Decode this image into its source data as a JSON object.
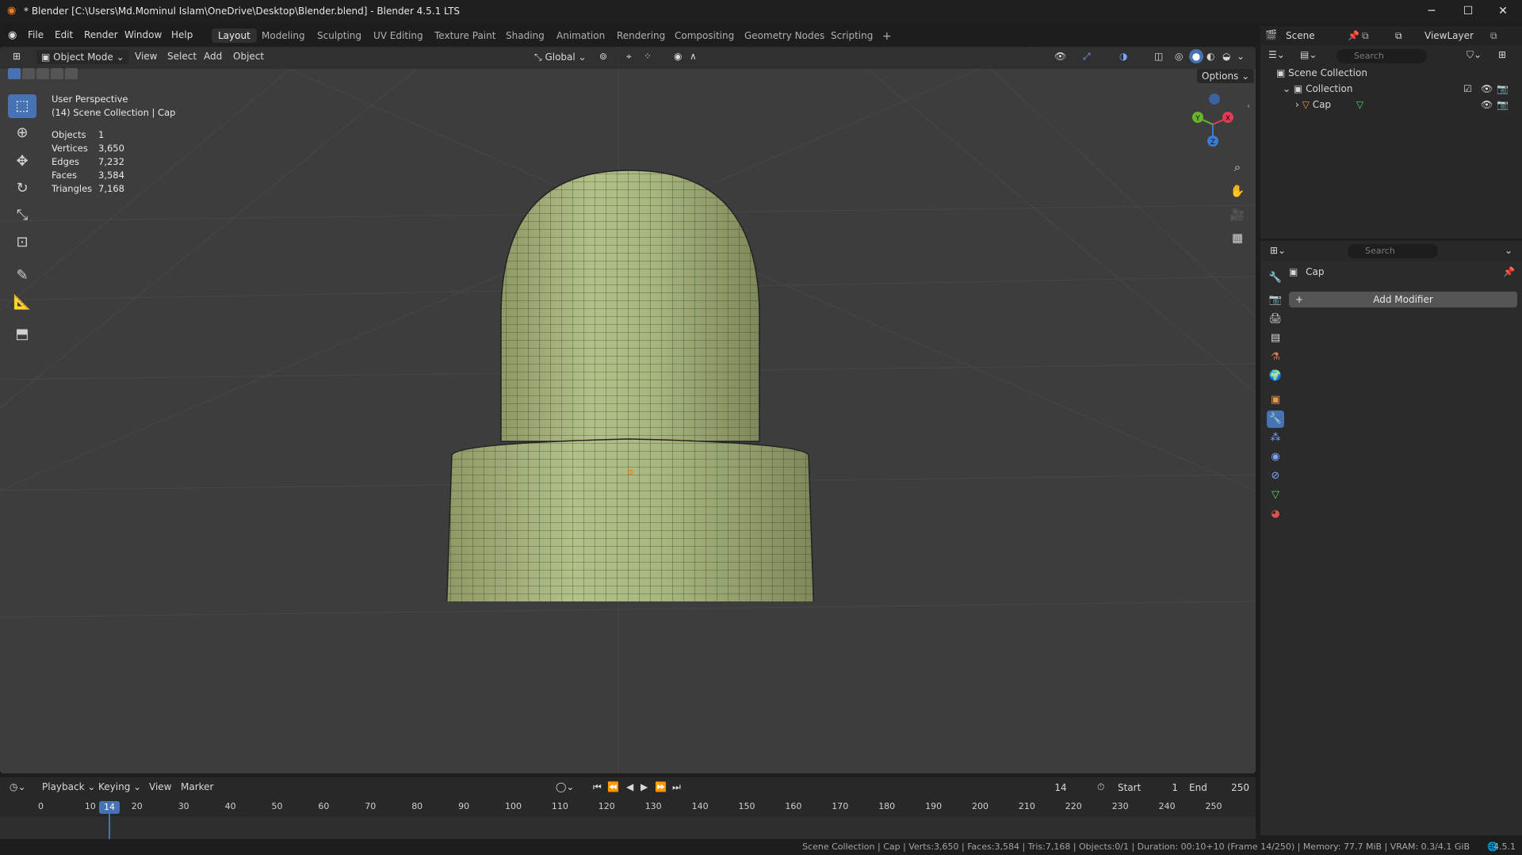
{
  "window": {
    "title": "* Blender [C:\\Users\\Md.Mominul Islam\\OneDrive\\Desktop\\Blender.blend] - Blender 4.5.1 LTS",
    "minimize": "─",
    "maximize": "☐",
    "close": "✕"
  },
  "menu": {
    "file": "File",
    "edit": "Edit",
    "render": "Render",
    "window": "Window",
    "help": "Help"
  },
  "workspaces": [
    "Layout",
    "Modeling",
    "Sculpting",
    "UV Editing",
    "Texture Paint",
    "Shading",
    "Animation",
    "Rendering",
    "Compositing",
    "Geometry Nodes",
    "Scripting"
  ],
  "workspace_add": "+",
  "viewport_header": {
    "mode": "Object Mode",
    "view": "View",
    "select": "Select",
    "add": "Add",
    "object": "Object",
    "transform_orientation": "Global",
    "options": "Options"
  },
  "overlay_info": {
    "perspective": "User Perspective",
    "collection_line": "(14) Scene Collection | Cap",
    "stats": [
      {
        "label": "Objects",
        "value": "1"
      },
      {
        "label": "Vertices",
        "value": "3,650"
      },
      {
        "label": "Edges",
        "value": "7,232"
      },
      {
        "label": "Faces",
        "value": "3,584"
      },
      {
        "label": "Triangles",
        "value": "7,168"
      }
    ]
  },
  "gizmo": {
    "x": "X",
    "y": "Y",
    "z": "Z"
  },
  "outliner": {
    "scene": "Scene",
    "view_layer": "ViewLayer",
    "search_placeholder": "Search",
    "scene_collection": "Scene Collection",
    "collection": "Collection",
    "object": "Cap"
  },
  "properties": {
    "search_placeholder": "Search",
    "object_name": "Cap",
    "add_modifier": "Add Modifier"
  },
  "timeline": {
    "playback": "Playback",
    "keying": "Keying",
    "view": "View",
    "marker": "Marker",
    "current_frame": "14",
    "start_label": "Start",
    "start_value": "1",
    "end_label": "End",
    "end_value": "250",
    "ruler": [
      "0",
      "10",
      "20",
      "30",
      "40",
      "50",
      "60",
      "70",
      "80",
      "90",
      "100",
      "110",
      "120",
      "130",
      "140",
      "150",
      "160",
      "170",
      "180",
      "190",
      "200",
      "210",
      "220",
      "230",
      "240",
      "250"
    ],
    "playhead": "14"
  },
  "status": {
    "text": "Scene Collection | Cap | Verts:3,650 | Faces:3,584 | Tris:7,168 | Objects:0/1 | Duration: 00:10+10 (Frame 14/250) | Memory: 77.7 MiB | VRAM: 0.3/4.1 GiB",
    "version": "4.5.1"
  },
  "colors": {
    "accent": "#4772b3",
    "mesh": "#a6b47c",
    "viewport_bg": "#3d3d3d"
  }
}
